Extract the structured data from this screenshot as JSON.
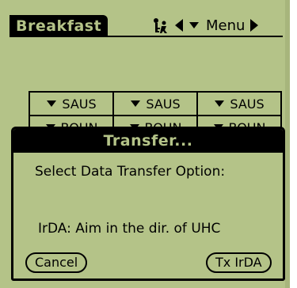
{
  "app": {
    "title": "Breakfast",
    "menu_label": "Menu"
  },
  "icons": {
    "status": "key-person-icon",
    "prev": "left-triangle-icon",
    "dropdown": "down-triangle-icon",
    "next": "right-triangle-icon"
  },
  "grid": {
    "rows": [
      [
        "SAUS",
        "SAUS",
        "SAUS"
      ],
      [
        "BOUN",
        "BOUN",
        "BOUN"
      ]
    ]
  },
  "dialog": {
    "title": "Transfer...",
    "prompt": "Select Data Transfer Option:",
    "info": "IrDA: Aim in the dir. of UHC",
    "cancel_label": "Cancel",
    "tx_label": "Tx IrDA"
  }
}
